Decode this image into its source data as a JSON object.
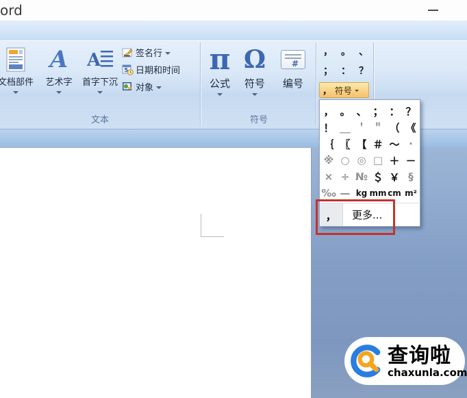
{
  "window": {
    "title": "ord"
  },
  "ribbon": {
    "text_group": {
      "label": "文本",
      "big_buttons": [
        {
          "label": "文档部件"
        },
        {
          "label": "艺术字"
        },
        {
          "label": "首字下沉"
        }
      ],
      "side_buttons": [
        {
          "label": "签名行"
        },
        {
          "label": "日期和时间"
        },
        {
          "label": "对象"
        }
      ]
    },
    "symbols_group": {
      "label": "符号",
      "buttons": [
        {
          "label": "公式",
          "glyph": "π"
        },
        {
          "label": "符号",
          "glyph": "Ω"
        },
        {
          "label": "编号",
          "glyph": "#"
        }
      ]
    },
    "quick_group": {
      "gallery": [
        [
          "，",
          "。",
          "、"
        ],
        [
          "；",
          "：",
          "？"
        ]
      ],
      "button": {
        "selected": "，",
        "label": "符号"
      }
    }
  },
  "symbol_dropdown": {
    "grid": [
      [
        {
          "ch": "，"
        },
        {
          "ch": "。"
        },
        {
          "ch": "、"
        },
        {
          "ch": "；"
        },
        {
          "ch": "："
        },
        {
          "ch": "？"
        }
      ],
      [
        {
          "ch": "！"
        },
        {
          "ch": "＿",
          "muted": true
        },
        {
          "ch": "＇",
          "muted": true
        },
        {
          "ch": "＂",
          "muted": true
        },
        {
          "ch": "（"
        },
        {
          "ch": "《"
        }
      ],
      [
        {
          "ch": "｛"
        },
        {
          "ch": "〖"
        },
        {
          "ch": "【"
        },
        {
          "ch": "＃"
        },
        {
          "ch": "～"
        },
        {
          "ch": "·",
          "muted": true
        }
      ],
      [
        {
          "ch": "※",
          "muted": true
        },
        {
          "ch": "○",
          "muted": true
        },
        {
          "ch": "◎",
          "muted": true
        },
        {
          "ch": "□",
          "muted": true
        },
        {
          "ch": "＋"
        },
        {
          "ch": "－"
        }
      ],
      [
        {
          "ch": "×",
          "muted": true
        },
        {
          "ch": "÷",
          "muted": true
        },
        {
          "ch": "№",
          "muted": true
        },
        {
          "ch": "＄"
        },
        {
          "ch": "￥"
        },
        {
          "ch": "§",
          "muted": true
        }
      ],
      [
        {
          "ch": "‰",
          "muted": true
        },
        {
          "ch": "—",
          "muted": true
        },
        {
          "ch": "kg",
          "small": true
        },
        {
          "ch": "mm",
          "small": true
        },
        {
          "ch": "cm",
          "small": true
        },
        {
          "ch": "m²",
          "small": true
        }
      ]
    ],
    "more": {
      "label": "更多...",
      "icon_symbol": "，"
    }
  },
  "watermark": {
    "brand": "查询啦",
    "domain": "chaxunla.com"
  },
  "colors": {
    "annotation_red": "#c4322d",
    "symbol_button_orange": "#f5c06e",
    "logo_blue": "#2a7de1",
    "logo_orange": "#f6a41f"
  }
}
